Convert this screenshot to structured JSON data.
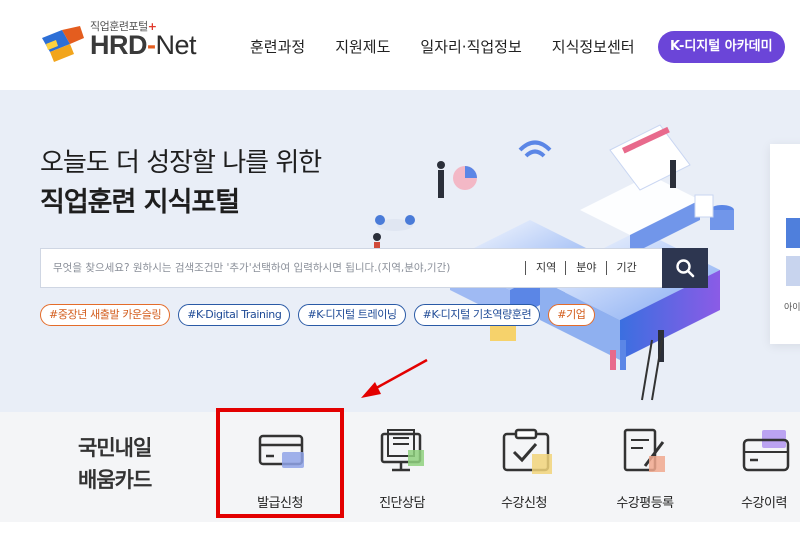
{
  "header": {
    "logo_sub": "직업훈련포털",
    "logo_plus": "+",
    "logo_hrd": "HRD",
    "logo_dash": "-",
    "logo_net": "Net",
    "nav": [
      "훈련과정",
      "지원제도",
      "일자리·직업정보",
      "지식정보센터"
    ],
    "cta_label": "K-디지털 아카데미"
  },
  "hero": {
    "title_line1": "오늘도 더 성장할 나를 위한",
    "title_line2": "직업훈련 지식포털",
    "search_placeholder": "무엇을 찾으세요? 원하시는 검색조건만 '추가'선택하여 입력하시면 됩니다.(지역,분야,기간)",
    "filters": [
      "지역",
      "분야",
      "기간"
    ],
    "tags": [
      {
        "label": "#중장년 새출발 카운슬링",
        "style": "orange"
      },
      {
        "label": "#K-Digital Training",
        "style": "blue"
      },
      {
        "label": "#K-디지털 트레이닝",
        "style": "blue"
      },
      {
        "label": "#K-디지털 기초역량훈련",
        "style": "blue"
      },
      {
        "label": "#기업",
        "style": "orange"
      }
    ],
    "side_text": "아이"
  },
  "bottom": {
    "card_title_line1": "국민내일",
    "card_title_line2": "배움카드",
    "menu": [
      {
        "label": "발급신청",
        "icon": "card-icon"
      },
      {
        "label": "진단상담",
        "icon": "consult-monitor-icon"
      },
      {
        "label": "수강신청",
        "icon": "enroll-check-icon"
      },
      {
        "label": "수강평등록",
        "icon": "review-write-icon"
      },
      {
        "label": "수강이력",
        "icon": "history-wallet-icon"
      }
    ]
  },
  "colors": {
    "brand_purple": "#6b45d8",
    "hero_bg": "#e9eef7",
    "search_button": "#2d3650",
    "highlight_red": "#e30000"
  }
}
